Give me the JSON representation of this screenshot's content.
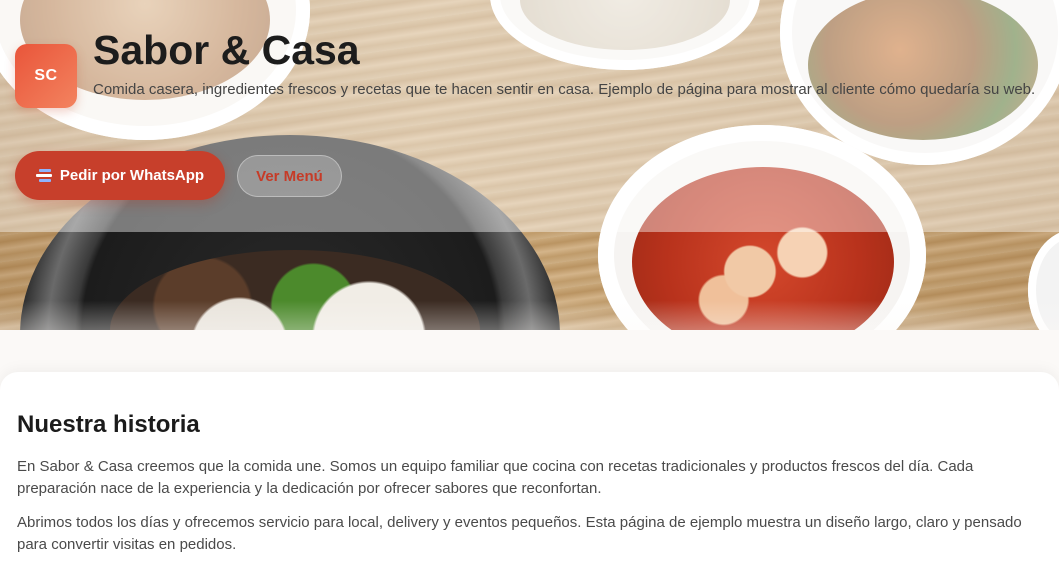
{
  "brand": {
    "initials": "SC",
    "title": "Sabor & Casa",
    "subtitle": "Comida casera, ingredientes frescos y recetas que te hacen sentir en casa. Ejemplo de página para mostrar al cliente cómo quedaría su web."
  },
  "actions": {
    "whatsapp_label": "Pedir por WhatsApp",
    "menu_label": "Ver Menú"
  },
  "story": {
    "heading": "Nuestra historia",
    "paragraphs": [
      "En Sabor & Casa creemos que la comida une. Somos un equipo familiar que cocina con recetas tradicionales y productos frescos del día. Cada preparación nace de la experiencia y la dedicación por ofrecer sabores que reconfortan.",
      "Abrimos todos los días y ofrecemos servicio para local, delivery y eventos pequeños. Esta página de ejemplo muestra un diseño largo, claro y pensado para convertir visitas en pedidos."
    ]
  },
  "colors": {
    "accent": "#c73f2b",
    "badge_gradient_start": "#e9553a",
    "badge_gradient_end": "#f3835f"
  },
  "icons": {
    "whatsapp": "chat-bubble-icon"
  }
}
